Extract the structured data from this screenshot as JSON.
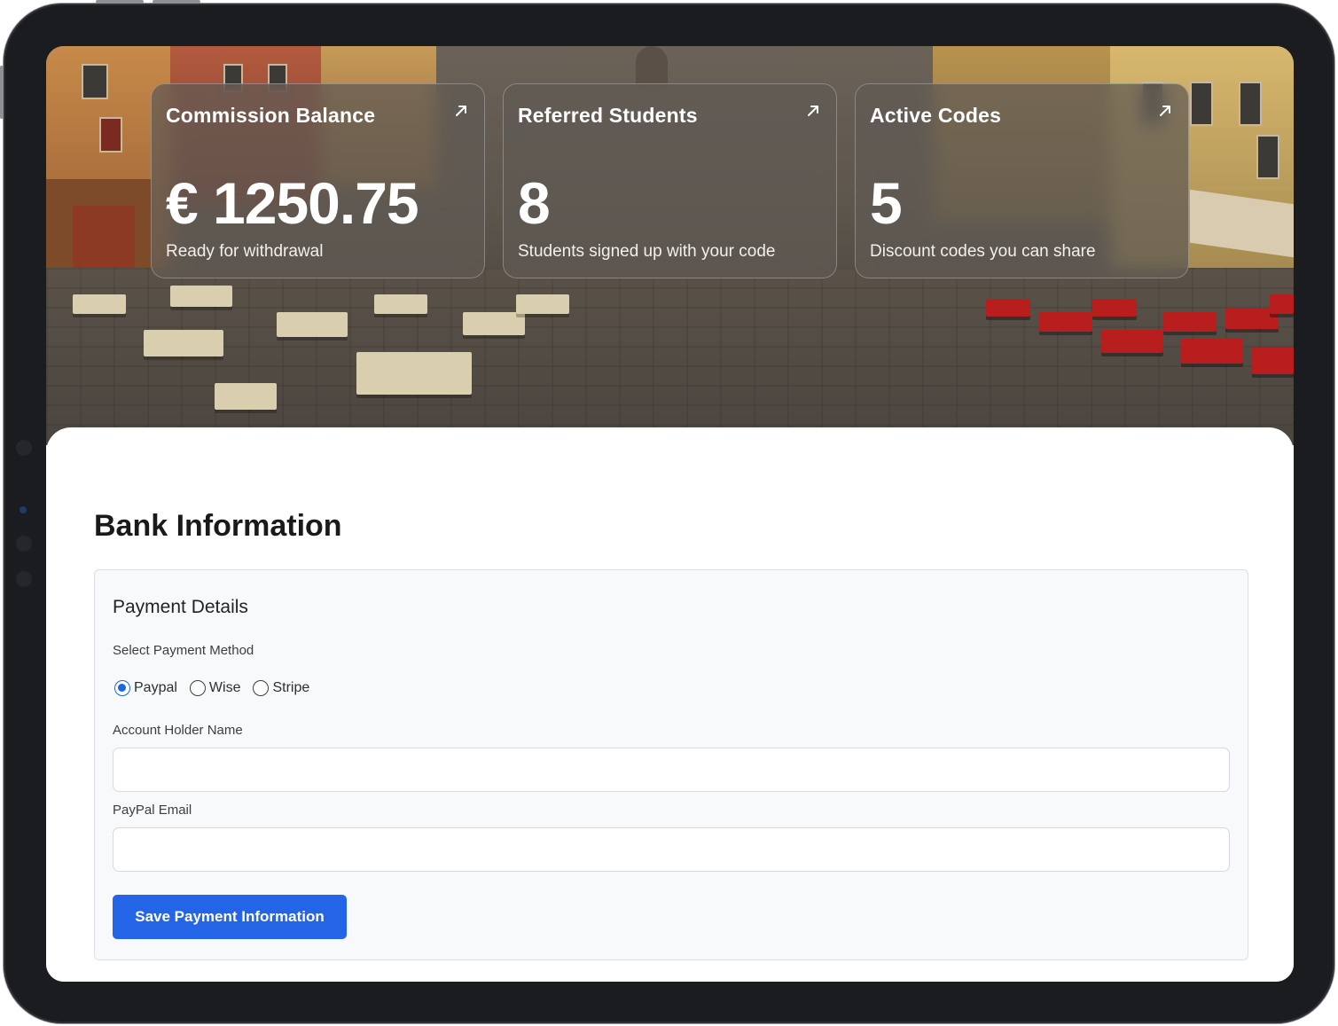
{
  "stats": [
    {
      "title": "Commission Balance",
      "value": "€ 1250.75",
      "subtitle": "Ready for withdrawal",
      "icon": "arrow-up-right-icon"
    },
    {
      "title": "Referred Students",
      "value": "8",
      "subtitle": "Students signed up with your code",
      "icon": "arrow-up-right-icon"
    },
    {
      "title": "Active Codes",
      "value": "5",
      "subtitle": "Discount codes you can share",
      "icon": "arrow-up-right-icon"
    }
  ],
  "bank": {
    "title": "Bank Information",
    "panel_title": "Payment Details",
    "method_label": "Select Payment Method",
    "methods": [
      {
        "label": "Paypal",
        "selected": true
      },
      {
        "label": "Wise",
        "selected": false
      },
      {
        "label": "Stripe",
        "selected": false
      }
    ],
    "account_holder_label": "Account Holder Name",
    "account_holder_value": "",
    "email_label": "PayPal Email",
    "email_value": "",
    "save_label": "Save Payment Information"
  },
  "colors": {
    "accent": "#2464e6",
    "radio_selected": "#1a66e0",
    "device_frame": "#1b1c1f"
  }
}
